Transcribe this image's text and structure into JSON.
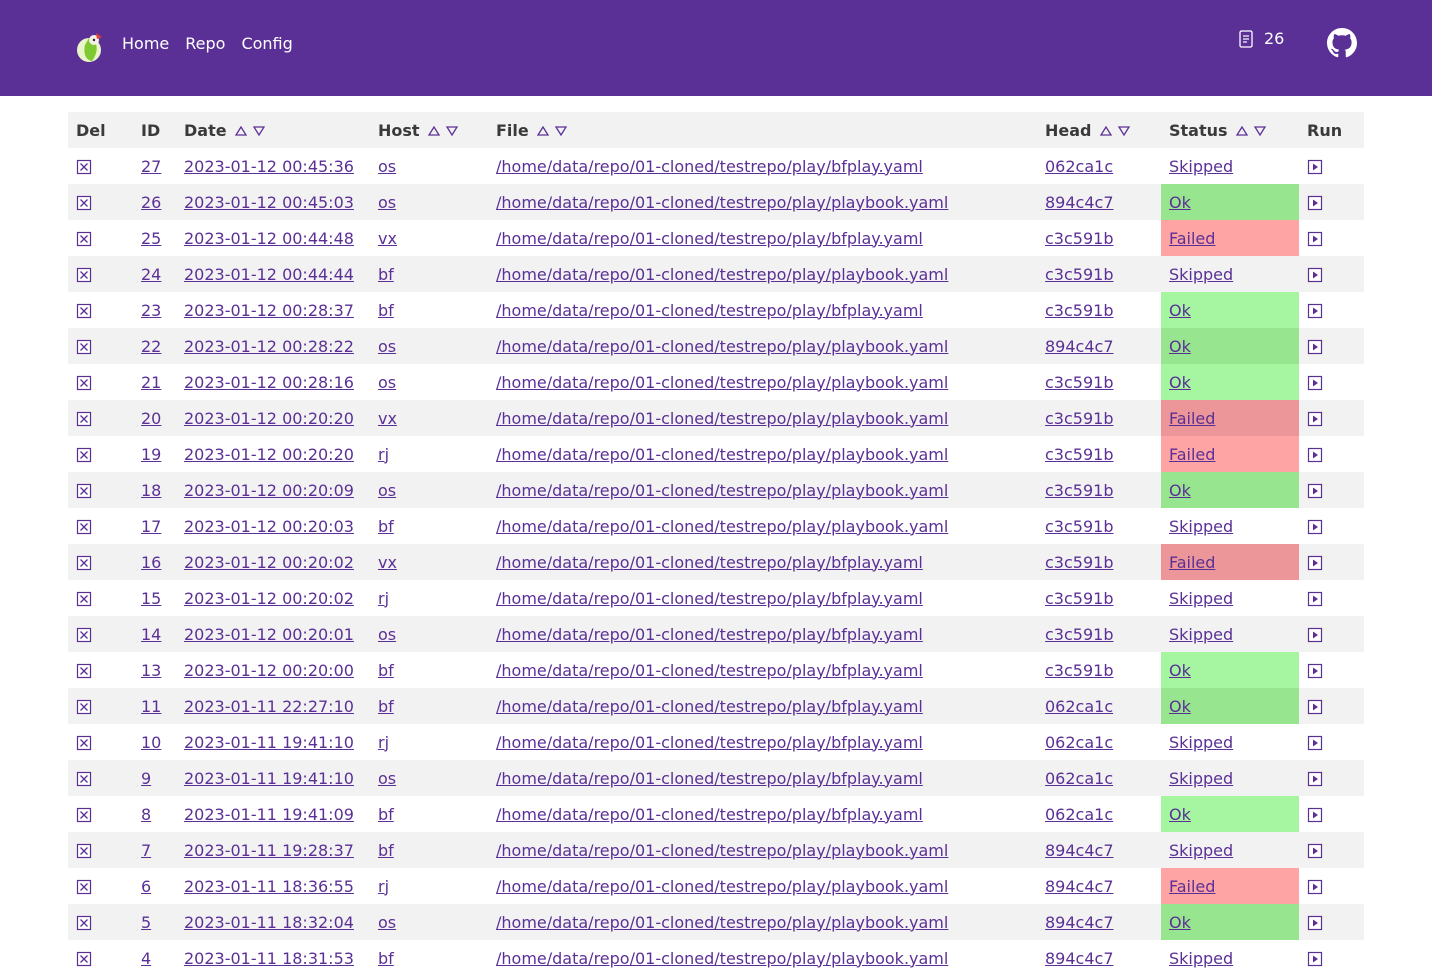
{
  "nav": {
    "home": "Home",
    "repo": "Repo",
    "config": "Config"
  },
  "header": {
    "count": "26",
    "count_icon": "document-icon",
    "repo_icon": "github-icon"
  },
  "colors": {
    "brand": "#5b3096",
    "ok": "#a6f5a0",
    "failed": "#ffa4a4",
    "stripe": "#f2f2f2"
  },
  "columns": {
    "del": "Del",
    "id": "ID",
    "date": "Date",
    "host": "Host",
    "file": "File",
    "head": "Head",
    "status": "Status",
    "run": "Run"
  },
  "rows": [
    {
      "id": "27",
      "date": "2023-01-12 00:45:36",
      "host": "os",
      "file": "/home/data/repo/01-cloned/testrepo/play/bfplay.yaml",
      "head": "062ca1c",
      "status": "Skipped"
    },
    {
      "id": "26",
      "date": "2023-01-12 00:45:03",
      "host": "os",
      "file": "/home/data/repo/01-cloned/testrepo/play/playbook.yaml",
      "head": "894c4c7",
      "status": "Ok"
    },
    {
      "id": "25",
      "date": "2023-01-12 00:44:48",
      "host": "vx",
      "file": "/home/data/repo/01-cloned/testrepo/play/bfplay.yaml",
      "head": "c3c591b",
      "status": "Failed"
    },
    {
      "id": "24",
      "date": "2023-01-12 00:44:44",
      "host": "bf",
      "file": "/home/data/repo/01-cloned/testrepo/play/playbook.yaml",
      "head": "c3c591b",
      "status": "Skipped"
    },
    {
      "id": "23",
      "date": "2023-01-12 00:28:37",
      "host": "bf",
      "file": "/home/data/repo/01-cloned/testrepo/play/bfplay.yaml",
      "head": "c3c591b",
      "status": "Ok"
    },
    {
      "id": "22",
      "date": "2023-01-12 00:28:22",
      "host": "os",
      "file": "/home/data/repo/01-cloned/testrepo/play/playbook.yaml",
      "head": "894c4c7",
      "status": "Ok"
    },
    {
      "id": "21",
      "date": "2023-01-12 00:28:16",
      "host": "os",
      "file": "/home/data/repo/01-cloned/testrepo/play/playbook.yaml",
      "head": "c3c591b",
      "status": "Ok"
    },
    {
      "id": "20",
      "date": "2023-01-12 00:20:20",
      "host": "vx",
      "file": "/home/data/repo/01-cloned/testrepo/play/playbook.yaml",
      "head": "c3c591b",
      "status": "Failed"
    },
    {
      "id": "19",
      "date": "2023-01-12 00:20:20",
      "host": "rj",
      "file": "/home/data/repo/01-cloned/testrepo/play/playbook.yaml",
      "head": "c3c591b",
      "status": "Failed"
    },
    {
      "id": "18",
      "date": "2023-01-12 00:20:09",
      "host": "os",
      "file": "/home/data/repo/01-cloned/testrepo/play/playbook.yaml",
      "head": "c3c591b",
      "status": "Ok"
    },
    {
      "id": "17",
      "date": "2023-01-12 00:20:03",
      "host": "bf",
      "file": "/home/data/repo/01-cloned/testrepo/play/playbook.yaml",
      "head": "c3c591b",
      "status": "Skipped"
    },
    {
      "id": "16",
      "date": "2023-01-12 00:20:02",
      "host": "vx",
      "file": "/home/data/repo/01-cloned/testrepo/play/bfplay.yaml",
      "head": "c3c591b",
      "status": "Failed"
    },
    {
      "id": "15",
      "date": "2023-01-12 00:20:02",
      "host": "rj",
      "file": "/home/data/repo/01-cloned/testrepo/play/bfplay.yaml",
      "head": "c3c591b",
      "status": "Skipped"
    },
    {
      "id": "14",
      "date": "2023-01-12 00:20:01",
      "host": "os",
      "file": "/home/data/repo/01-cloned/testrepo/play/bfplay.yaml",
      "head": "c3c591b",
      "status": "Skipped"
    },
    {
      "id": "13",
      "date": "2023-01-12 00:20:00",
      "host": "bf",
      "file": "/home/data/repo/01-cloned/testrepo/play/bfplay.yaml",
      "head": "c3c591b",
      "status": "Ok"
    },
    {
      "id": "11",
      "date": "2023-01-11 22:27:10",
      "host": "bf",
      "file": "/home/data/repo/01-cloned/testrepo/play/bfplay.yaml",
      "head": "062ca1c",
      "status": "Ok"
    },
    {
      "id": "10",
      "date": "2023-01-11 19:41:10",
      "host": "rj",
      "file": "/home/data/repo/01-cloned/testrepo/play/bfplay.yaml",
      "head": "062ca1c",
      "status": "Skipped"
    },
    {
      "id": "9",
      "date": "2023-01-11 19:41:10",
      "host": "os",
      "file": "/home/data/repo/01-cloned/testrepo/play/bfplay.yaml",
      "head": "062ca1c",
      "status": "Skipped"
    },
    {
      "id": "8",
      "date": "2023-01-11 19:41:09",
      "host": "bf",
      "file": "/home/data/repo/01-cloned/testrepo/play/bfplay.yaml",
      "head": "062ca1c",
      "status": "Ok"
    },
    {
      "id": "7",
      "date": "2023-01-11 19:28:37",
      "host": "bf",
      "file": "/home/data/repo/01-cloned/testrepo/play/playbook.yaml",
      "head": "894c4c7",
      "status": "Skipped"
    },
    {
      "id": "6",
      "date": "2023-01-11 18:36:55",
      "host": "rj",
      "file": "/home/data/repo/01-cloned/testrepo/play/playbook.yaml",
      "head": "894c4c7",
      "status": "Failed"
    },
    {
      "id": "5",
      "date": "2023-01-11 18:32:04",
      "host": "os",
      "file": "/home/data/repo/01-cloned/testrepo/play/playbook.yaml",
      "head": "894c4c7",
      "status": "Ok"
    },
    {
      "id": "4",
      "date": "2023-01-11 18:31:53",
      "host": "bf",
      "file": "/home/data/repo/01-cloned/testrepo/play/playbook.yaml",
      "head": "894c4c7",
      "status": "Skipped"
    }
  ]
}
